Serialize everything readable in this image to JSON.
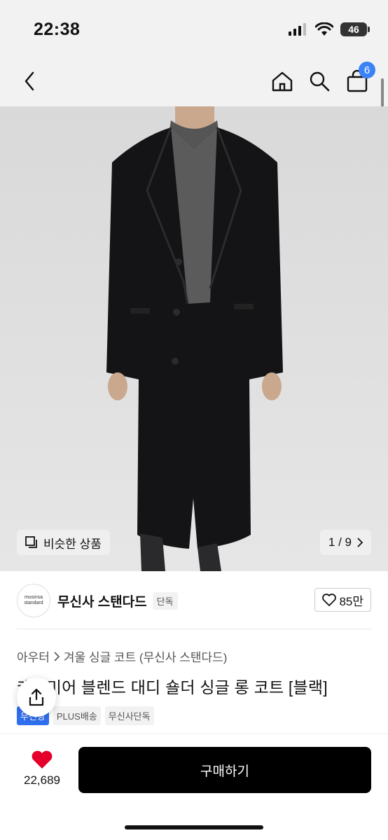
{
  "status": {
    "time": "22:38",
    "battery": "46"
  },
  "nav": {
    "cart_count": "6"
  },
  "hero": {
    "similar_label": "비슷한 상품",
    "counter": "1 / 9"
  },
  "brand": {
    "logo_line1": "musinsa",
    "logo_line2": "standard",
    "name": "무신사 스탠다드",
    "tag": "단독",
    "likes": "85만"
  },
  "breadcrumb": {
    "category": "아우터",
    "subcategory": "겨울 싱글 코트 (무신사 스탠다드)"
  },
  "product": {
    "title": "캐시미어 블렌드 대디 숄더 싱글 롱 코트 [블랙]",
    "tags": [
      "무진장",
      "PLUS배송",
      "무신사단독"
    ]
  },
  "bottom": {
    "favorite_count": "22,689",
    "buy_label": "구매하기"
  },
  "colors": {
    "accent": "#2f6ff0",
    "badge": "#3b82f6",
    "heart": "#e4002b"
  }
}
